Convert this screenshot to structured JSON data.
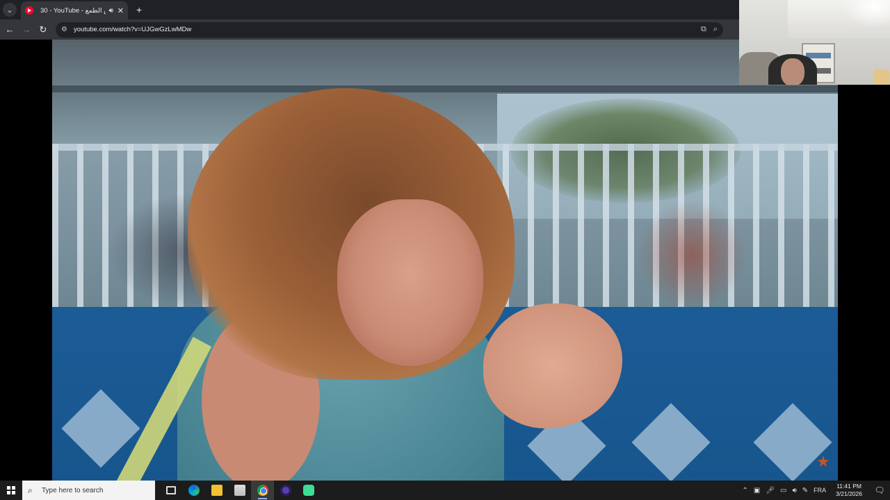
{
  "browser": {
    "tab": {
      "title": "30 - YouTube - عش الطمع",
      "audio_icon": "speaker-icon",
      "close_label": "✕"
    },
    "new_tab_label": "+",
    "tab_menu_label": "⌄",
    "url": "youtube.com/watch?v=UJGwGzLwMDw"
  },
  "video": {
    "watermark_icon": "channel-logo-icon"
  },
  "taskbar": {
    "search_placeholder": "Type here to search",
    "apps": [
      "task-view",
      "edge",
      "file-explorer",
      "store",
      "chrome",
      "obs",
      "app"
    ],
    "active_app": "chrome",
    "language": "FRA",
    "time": "11:41 PM",
    "date": "3/21/2026"
  },
  "colors": {
    "tabstrip": "#202124",
    "toolbar": "#35363a",
    "taskbar": "#1c1c1c",
    "youtube_red": "#ff0033"
  }
}
